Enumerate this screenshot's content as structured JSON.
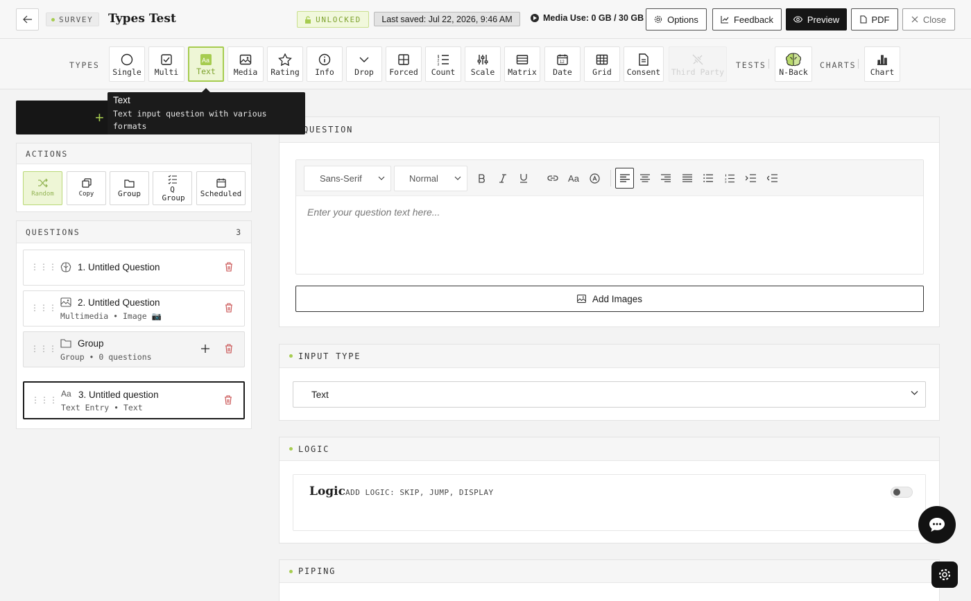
{
  "header": {
    "survey_tag": "SURVEY",
    "title": "Types Test",
    "unlocked_label": "UNLOCKED",
    "last_saved": "Last saved: Jul 22, 2026, 9:46 AM",
    "media_use": "Media Use: 0 GB / 30 GB",
    "buttons": {
      "options": "Options",
      "feedback": "Feedback",
      "preview": "Preview",
      "pdf": "PDF",
      "close": "Close"
    }
  },
  "toolbar": {
    "types_label": "TYPES",
    "tests_label": "TESTS",
    "charts_label": "CHARTS",
    "types": [
      {
        "label": "Single",
        "icon": "circle-icon"
      },
      {
        "label": "Multi",
        "icon": "checkbox-icon"
      },
      {
        "label": "Text",
        "icon": "text-aa-icon",
        "active": true
      },
      {
        "label": "Media",
        "icon": "image-icon"
      },
      {
        "label": "Rating",
        "icon": "star-icon"
      },
      {
        "label": "Info",
        "icon": "info-icon"
      },
      {
        "label": "Drop",
        "icon": "chevron-down-icon"
      },
      {
        "label": "Forced",
        "icon": "grid-icon"
      },
      {
        "label": "Count",
        "icon": "numbered-list-icon"
      },
      {
        "label": "Scale",
        "icon": "sliders-icon"
      },
      {
        "label": "Matrix",
        "icon": "table-icon"
      },
      {
        "label": "Date",
        "icon": "calendar-icon"
      },
      {
        "label": "Grid",
        "icon": "grid-table-icon"
      },
      {
        "label": "Consent",
        "icon": "document-icon"
      },
      {
        "label": "Third Party",
        "icon": "plug-icon",
        "disabled": true
      }
    ],
    "tests": [
      {
        "label": "N-Back",
        "icon": "brain-icon"
      }
    ],
    "charts": [
      {
        "label": "Chart",
        "icon": "bar-chart-icon"
      }
    ]
  },
  "tooltip": {
    "title": "Text",
    "description": "Text input question with various formats"
  },
  "actions": {
    "header": "ACTIONS",
    "items": [
      {
        "label": "Random",
        "icon": "shuffle-icon",
        "active": true
      },
      {
        "label": "Copy",
        "icon": "copy-icon"
      },
      {
        "label": "Group",
        "icon": "folder-icon"
      },
      {
        "label": "Q Group",
        "icon": "list-check-icon"
      },
      {
        "label": "Scheduled",
        "icon": "calendar-icon"
      }
    ]
  },
  "questions": {
    "header": "QUESTIONS",
    "count": "3",
    "items": [
      {
        "title": "1. Untitled Question",
        "subtitle": "",
        "icon": "brain-icon"
      },
      {
        "title": "2. Untitled Question",
        "subtitle": "Multimedia • Image 📷",
        "icon": "image-icon"
      },
      {
        "title": "Group",
        "subtitle": "Group • 0 questions",
        "icon": "folder-icon"
      },
      {
        "title": "3. Untitled question",
        "subtitle": "Text Entry • Text",
        "icon": "text-aa-icon",
        "selected": true
      }
    ]
  },
  "question_card": {
    "header": "QUESTION",
    "font_select": "Sans-Serif",
    "size_select": "Normal",
    "placeholder": "Enter your question text here...",
    "add_images": "Add Images"
  },
  "input_type_card": {
    "header": "INPUT TYPE",
    "value": "Text"
  },
  "logic_card": {
    "header": "LOGIC",
    "title": "Logic",
    "subtitle": "ADD LOGIC: SKIP, JUMP, DISPLAY",
    "enabled": false
  },
  "piping_card": {
    "header": "PIPING"
  },
  "colors": {
    "accent": "#a6cc4f",
    "dark": "#161616",
    "danger": "#c74b4b"
  }
}
